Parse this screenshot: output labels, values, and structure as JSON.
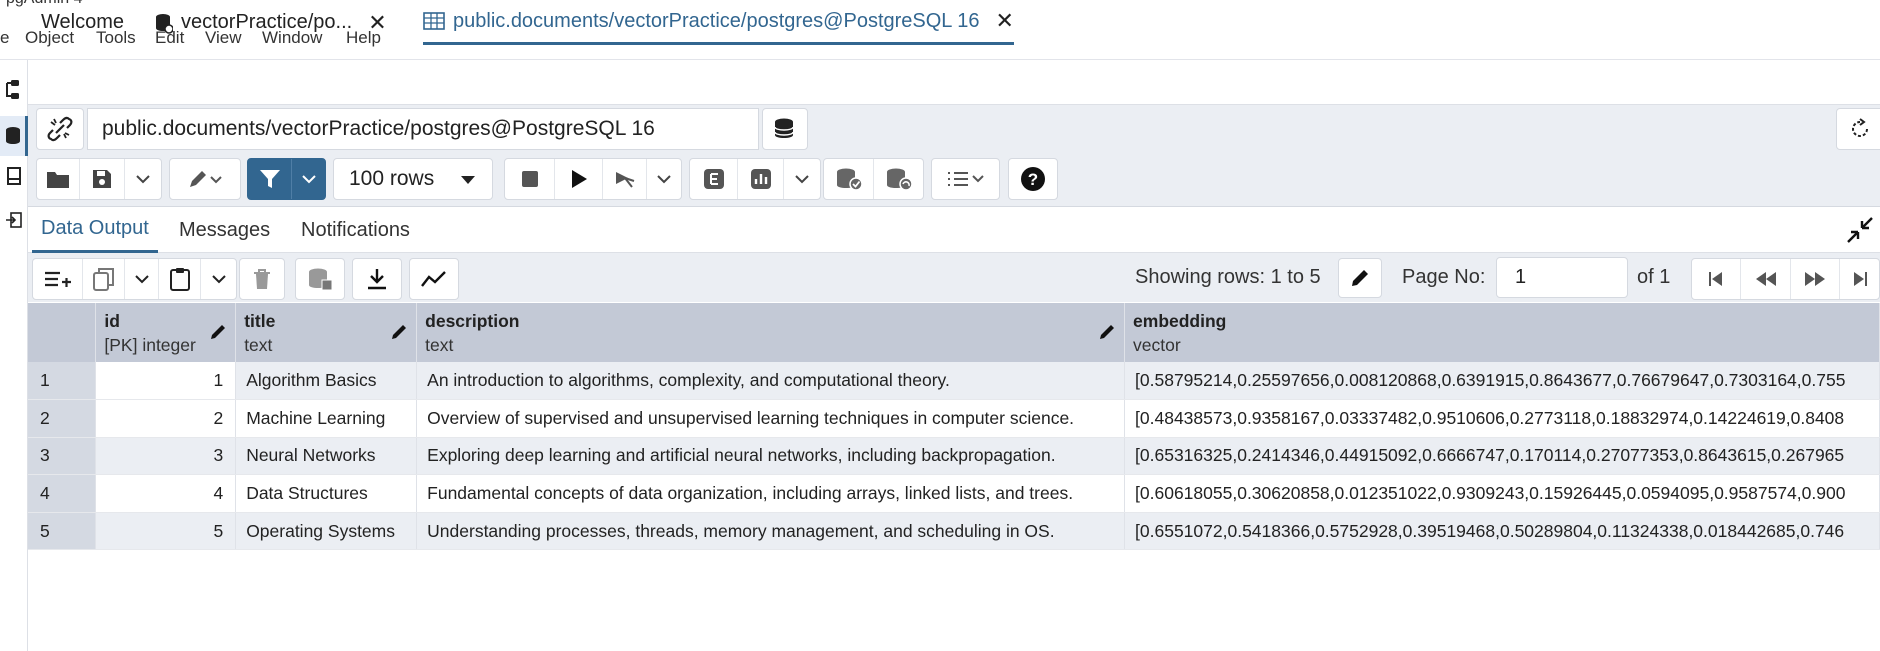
{
  "window": {
    "title": "pgAdmin 4"
  },
  "menu": [
    "e",
    "Object",
    "Tools",
    "Edit",
    "View",
    "Window",
    "Help"
  ],
  "tabs": [
    {
      "label": "Welcome"
    },
    {
      "label": "vectorPractice/po..."
    },
    {
      "label": "public.documents/vectorPractice/postgres@PostgreSQL 16"
    }
  ],
  "connection": {
    "value": "public.documents/vectorPractice/postgres@PostgreSQL 16"
  },
  "toolbar": {
    "rows_limit": "100 rows"
  },
  "result_tabs": [
    "Data Output",
    "Messages",
    "Notifications"
  ],
  "pagination": {
    "showing": "Showing rows: 1 to 5",
    "page_label": "Page No:",
    "page": "1",
    "of": "of 1"
  },
  "columns": [
    {
      "name": "id",
      "type": "[PK] integer"
    },
    {
      "name": "title",
      "type": "text"
    },
    {
      "name": "description",
      "type": "text"
    },
    {
      "name": "embedding",
      "type": "vector"
    }
  ],
  "rows": [
    {
      "rownum": "1",
      "id": "1",
      "title": "Algorithm Basics",
      "description": "An introduction to algorithms, complexity, and computational theory.",
      "embedding": "[0.58795214,0.25597656,0.008120868,0.6391915,0.8643677,0.76679647,0.7303164,0.755"
    },
    {
      "rownum": "2",
      "id": "2",
      "title": "Machine Learning",
      "description": "Overview of supervised and unsupervised learning techniques in computer science.",
      "embedding": "[0.48438573,0.9358167,0.03337482,0.9510606,0.2773118,0.18832974,0.14224619,0.8408"
    },
    {
      "rownum": "3",
      "id": "3",
      "title": "Neural Networks",
      "description": "Exploring deep learning and artificial neural networks, including backpropagation.",
      "embedding": "[0.65316325,0.2414346,0.44915092,0.6666747,0.170114,0.27077353,0.8643615,0.267965"
    },
    {
      "rownum": "4",
      "id": "4",
      "title": "Data Structures",
      "description": "Fundamental concepts of data organization, including arrays, linked lists, and trees.",
      "embedding": "[0.60618055,0.30620858,0.012351022,0.9309243,0.15926445,0.0594095,0.9587574,0.900"
    },
    {
      "rownum": "5",
      "id": "5",
      "title": "Operating Systems",
      "description": "Understanding processes, threads, memory management, and scheduling in OS.",
      "embedding": "[0.6551072,0.5418366,0.5752928,0.39519468,0.50289804,0.11324338,0.018442685,0.746"
    }
  ],
  "colors": {
    "accent": "#326690",
    "header_bg": "#c3c9d6",
    "toolbar_bg": "#ebeef3"
  }
}
